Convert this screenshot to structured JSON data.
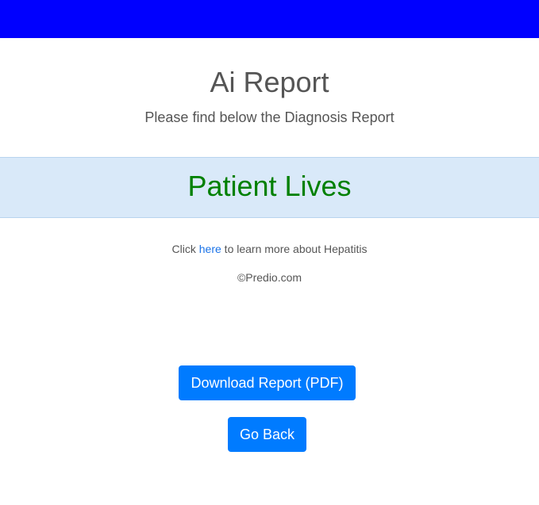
{
  "colors": {
    "topbar": "#0000ff",
    "result": "#008000",
    "band": "#d9e9f9",
    "button": "#007bff",
    "link": "#1a73e8"
  },
  "header": {
    "title": "Ai Report",
    "subtitle": "Please find below the Diagnosis Report"
  },
  "result": {
    "text": "Patient Lives"
  },
  "info": {
    "prefix": "Click ",
    "link_text": "here",
    "suffix": " to learn more about Hepatitis"
  },
  "footer": {
    "copyright": "©Predio.com"
  },
  "buttons": {
    "download_label": "Download Report (PDF)",
    "back_label": "Go Back"
  }
}
